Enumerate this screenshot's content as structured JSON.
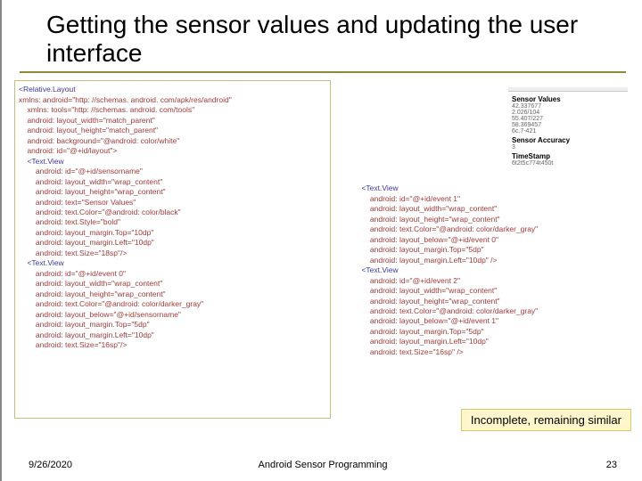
{
  "slide": {
    "title": "Getting the sensor values and updating the user interface"
  },
  "codeLeft": [
    {
      "i": 0,
      "c": "tag",
      "t": "<Relative.Layout"
    },
    {
      "i": 0,
      "c": "attr",
      "t": "xmlns: android=\"http: //schemas. android. com/apk/res/android\""
    },
    {
      "i": 1,
      "c": "attr",
      "t": "xmlns: tools=\"http: //schemas. android. com/tools\""
    },
    {
      "i": 1,
      "c": "attr",
      "t": "android: layout_width=\"match_parent\""
    },
    {
      "i": 1,
      "c": "attr",
      "t": "android: layout_height=\"match_parent\""
    },
    {
      "i": 1,
      "c": "attr",
      "t": "android: background=\"@android: color/white\""
    },
    {
      "i": 1,
      "c": "attr",
      "t": "android: id=\"@+id/layout\">"
    },
    {
      "i": 1,
      "c": "tag",
      "t": "<Text.View"
    },
    {
      "i": 2,
      "c": "attr",
      "t": "android: id=\"@+id/sensorname\""
    },
    {
      "i": 2,
      "c": "attr",
      "t": "android: layout_width=\"wrap_content\""
    },
    {
      "i": 2,
      "c": "attr",
      "t": "android: layout_height=\"wrap_content\""
    },
    {
      "i": 2,
      "c": "attr",
      "t": "android: text=\"Sensor Values\""
    },
    {
      "i": 2,
      "c": "attr",
      "t": "android: text.Color=\"@android: color/black\""
    },
    {
      "i": 2,
      "c": "attr",
      "t": "android: text.Style=\"bold\""
    },
    {
      "i": 2,
      "c": "attr",
      "t": "android: layout_margin.Top=\"10dp\""
    },
    {
      "i": 2,
      "c": "attr",
      "t": "android: layout_margin.Left=\"10dp\""
    },
    {
      "i": 2,
      "c": "attr",
      "t": "android: text.Size=\"18sp\"/>"
    },
    {
      "i": 1,
      "c": "tag",
      "t": "<Text.View"
    },
    {
      "i": 2,
      "c": "attr",
      "t": "android: id=\"@+id/event 0\""
    },
    {
      "i": 2,
      "c": "attr",
      "t": "android: layout_width=\"wrap_content\""
    },
    {
      "i": 2,
      "c": "attr",
      "t": "android: layout_height=\"wrap_content\""
    },
    {
      "i": 2,
      "c": "attr",
      "t": "android: text.Color=\"@android: color/darker_gray\""
    },
    {
      "i": 2,
      "c": "attr",
      "t": "android: layout_below=\"@+id/sensorname\""
    },
    {
      "i": 2,
      "c": "attr",
      "t": "android: layout_margin.Top=\"5dp\""
    },
    {
      "i": 2,
      "c": "attr",
      "t": "android: layout_margin.Left=\"10dp\""
    },
    {
      "i": 2,
      "c": "attr",
      "t": "android: text.Size=\"16sp\"/>"
    }
  ],
  "codeRight": [
    {
      "i": 1,
      "c": "tag",
      "t": "<Text.View"
    },
    {
      "i": 2,
      "c": "attr",
      "t": "android: id=\"@+id/event 1\""
    },
    {
      "i": 2,
      "c": "attr",
      "t": "android: layout_width=\"wrap_content\""
    },
    {
      "i": 2,
      "c": "attr",
      "t": "android: layout_height=\"wrap_content\""
    },
    {
      "i": 2,
      "c": "attr",
      "t": "android: text.Color=\"@android: color/darker_gray\""
    },
    {
      "i": 2,
      "c": "attr",
      "t": "android: layout_below=\"@+id/event 0\""
    },
    {
      "i": 2,
      "c": "attr",
      "t": "android: layout_margin.Top=\"5dp\""
    },
    {
      "i": 2,
      "c": "attr",
      "t": "android: layout_margin.Left=\"10dp\" />"
    },
    {
      "i": 1,
      "c": "tag",
      "t": "<Text.View"
    },
    {
      "i": 2,
      "c": "attr",
      "t": "android: id=\"@+id/event 2\""
    },
    {
      "i": 2,
      "c": "attr",
      "t": "android: layout_width=\"wrap_content\""
    },
    {
      "i": 2,
      "c": "attr",
      "t": "android: layout_height=\"wrap_content\""
    },
    {
      "i": 2,
      "c": "attr",
      "t": "android: text.Color=\"@android: color/darker_gray\""
    },
    {
      "i": 2,
      "c": "attr",
      "t": "android: layout_below=\"@+id/event 1\""
    },
    {
      "i": 2,
      "c": "attr",
      "t": "android: layout_margin.Top=\"5dp\""
    },
    {
      "i": 2,
      "c": "attr",
      "t": "android: layout_margin.Left=\"10dp\""
    },
    {
      "i": 2,
      "c": "attr",
      "t": "android: text.Size=\"16sp\" />"
    }
  ],
  "incomplete": "Incomplete, remaining similar",
  "preview": {
    "topbar_left": "",
    "topbar_right": "",
    "h1": "Sensor Values",
    "v1": "42.337677",
    "v2": "2.026/104",
    "v3": "55.407/227",
    "v4": "58.369457",
    "v5": "6c.7-421",
    "h2": "Sensor Accuracy",
    "a1": "3",
    "h3": "TimeStamp",
    "t1": "6t2t5c774t450t"
  },
  "footer": {
    "date": "9/26/2020",
    "center": "Android Sensor Programming",
    "page": "23"
  }
}
